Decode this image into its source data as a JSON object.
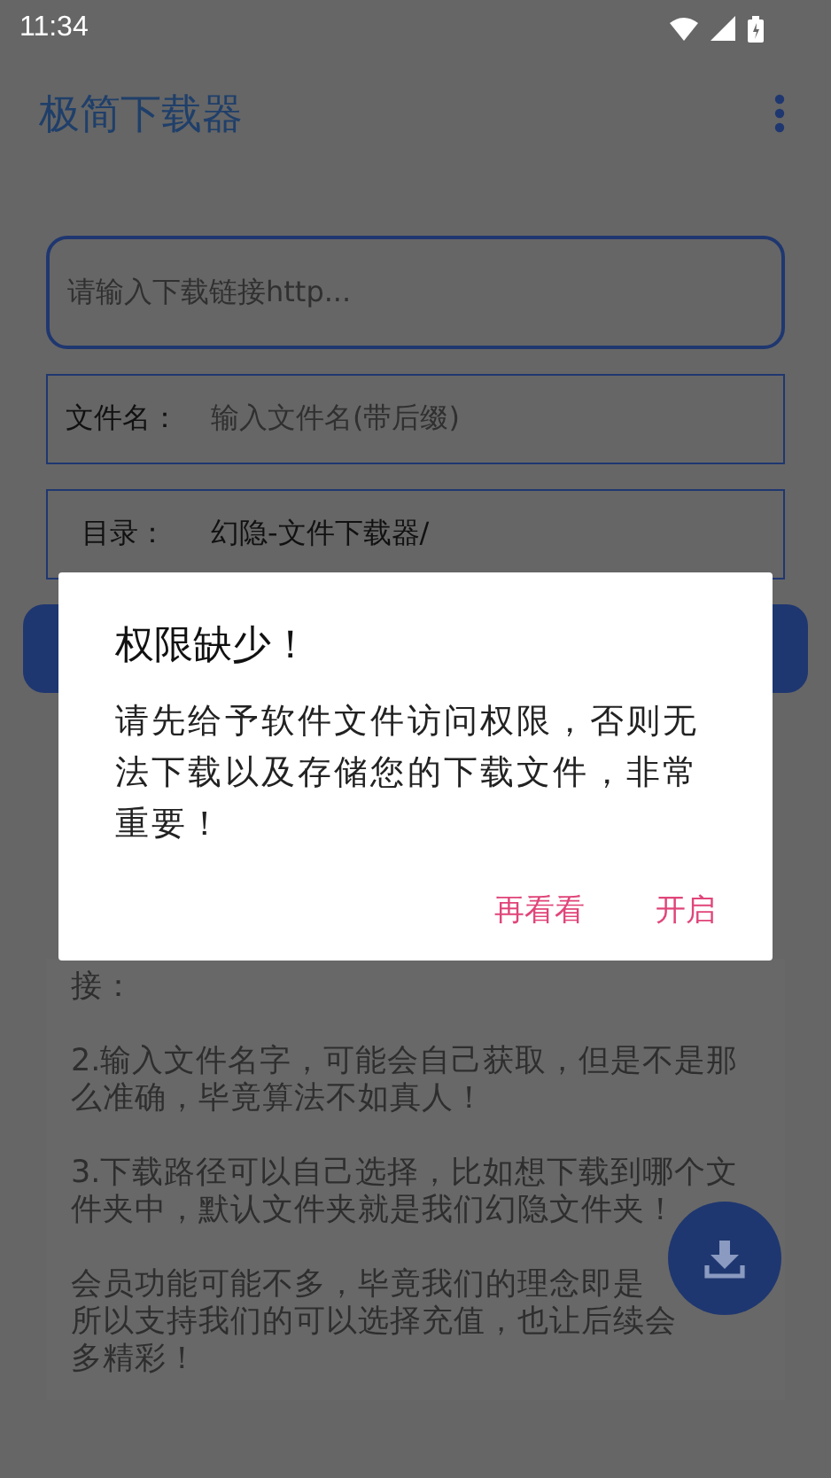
{
  "status_bar": {
    "time": "11:34"
  },
  "app_bar": {
    "title": "极简下载器"
  },
  "url_field": {
    "placeholder": "请输入下载链接http..."
  },
  "filename_row": {
    "label": "文件名：",
    "placeholder": "输入文件名(带后缀)"
  },
  "directory_row": {
    "label": "目录：",
    "value": "幻隐-文件下载器/"
  },
  "instructions": [
    {
      "lines": [
        "接："
      ]
    },
    {
      "lines": [
        "2.输入文件名字，可能会自己获取，但是不是那",
        "么准确，毕竟算法不如真人！"
      ]
    },
    {
      "lines": [
        "3.下载路径可以自己选择，比如想下载到哪个文",
        "件夹中，默认文件夹就是我们幻隐文件夹！"
      ]
    },
    {
      "lines": [
        "会员功能可能不多，毕竟我们的理念即是",
        "所以支持我们的可以选择充值，也让后续会",
        "多精彩！"
      ]
    }
  ],
  "dialog": {
    "title": "权限缺少！",
    "message": "请先给予软件文件访问权限，否则无法下载以及存储您的下载文件，非常重要！",
    "buttons": [
      "再看看",
      "开启"
    ]
  }
}
